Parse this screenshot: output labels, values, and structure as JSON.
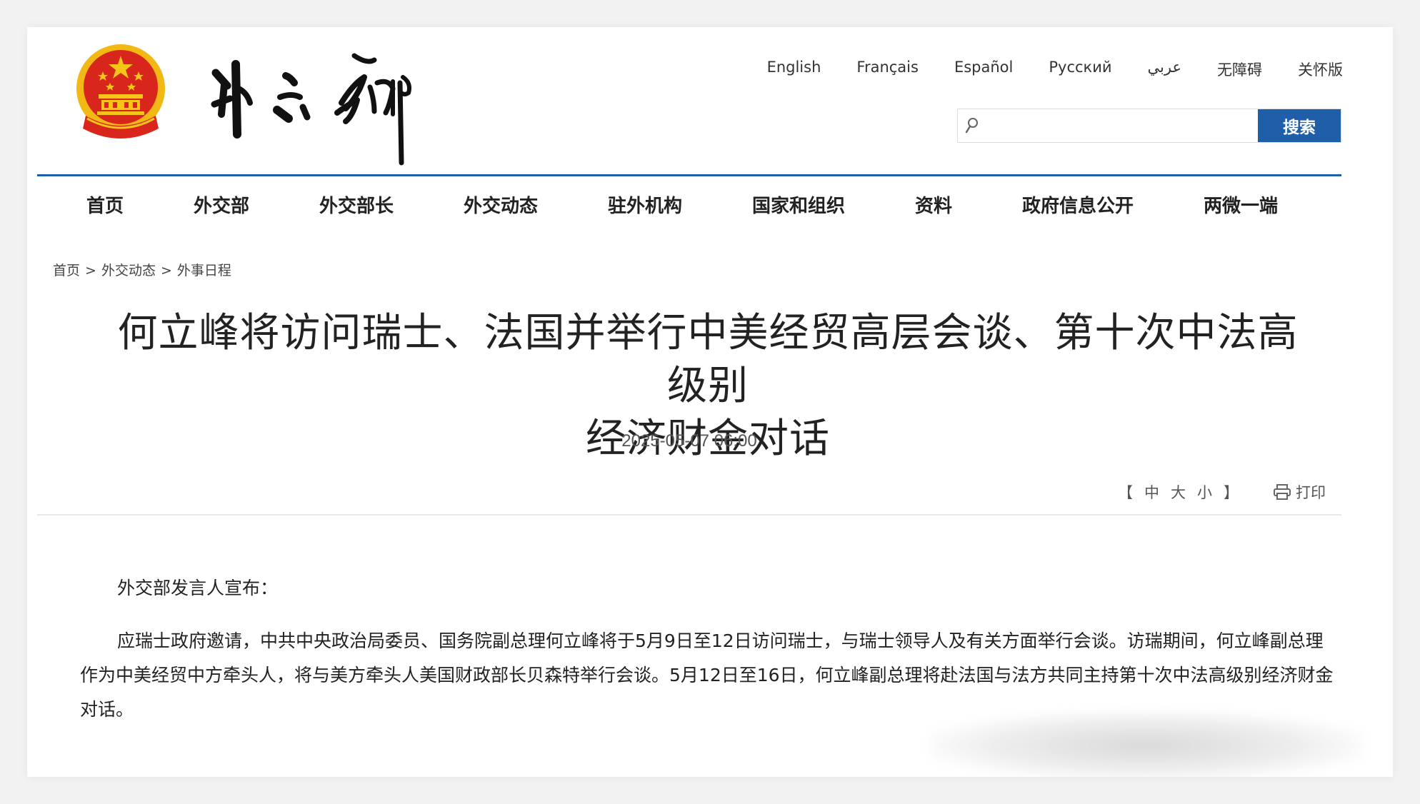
{
  "header": {
    "site_logo_text": "外交部",
    "languages": [
      "English",
      "Français",
      "Español",
      "Русский",
      "عربي",
      "无障碍",
      "关怀版"
    ],
    "search": {
      "placeholder": "",
      "button_label": "搜索"
    }
  },
  "nav": {
    "items": [
      "首页",
      "外交部",
      "外交部长",
      "外交动态",
      "驻外机构",
      "国家和组织",
      "资料",
      "政府信息公开",
      "两微一端"
    ]
  },
  "breadcrumb": {
    "items": [
      "首页",
      "外交动态",
      "外事日程"
    ],
    "separator": ">"
  },
  "article": {
    "title_line1": "何立峰将访问瑞士、法国并举行中美经贸高层会谈、第十次中法高级别",
    "title_line2": "经济财金对话",
    "date": "2025-05-07 06:00",
    "font_size": {
      "open": "【",
      "large": "中",
      "medium": "大",
      "small": "小",
      "close": "】"
    },
    "print_label": "打印",
    "paragraphs": [
      "外交部发言人宣布：",
      "应瑞士政府邀请，中共中央政治局委员、国务院副总理何立峰将于5月9日至12日访问瑞士，与瑞士领导人及有关方面举行会谈。访瑞期间，何立峰副总理作为中美经贸中方牵头人，将与美方牵头人美国财政部长贝森特举行会谈。5月12日至16日，何立峰副总理将赴法国与法方共同主持第十次中法高级别经济财金对话。"
    ]
  },
  "colors": {
    "accent": "#1f5ea8",
    "emblem_red": "#d9261c",
    "emblem_gold": "#f5c518"
  }
}
